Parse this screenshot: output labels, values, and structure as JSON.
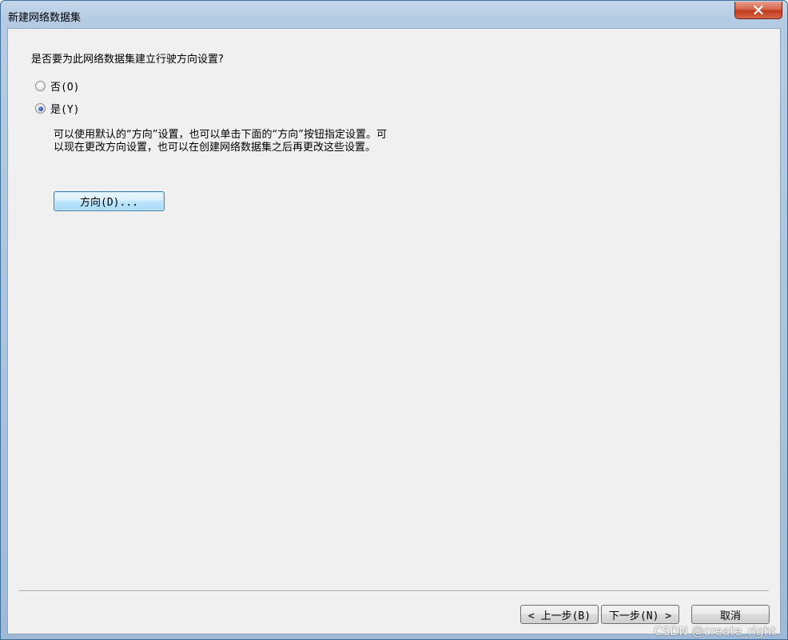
{
  "window": {
    "title": "新建网络数据集"
  },
  "question": "是否要为此网络数据集建立行驶方向设置?",
  "options": [
    {
      "label": "否(O)",
      "checked": false
    },
    {
      "label": "是(Y)",
      "checked": true
    }
  ],
  "description": {
    "line1": "可以使用默认的“方向”设置，也可以单击下面的“方向”按钮指定设置。可",
    "line2": "以现在更改方向设置，也可以在创建网络数据集之后再更改这些设置。"
  },
  "directions_button": "方向(D)...",
  "footer": {
    "back_label": "< 上一步(B)",
    "next_label": "下一步(N) >",
    "cancel_label": "取消"
  },
  "watermark": "CSDN @create_right",
  "colors": {
    "accent": "#3c7fb1",
    "close_red": "#c13a1d",
    "panel_bg": "#f0f0f0"
  },
  "icons": {
    "close": "close-x-icon",
    "radio_unchecked": "radio-unchecked-icon",
    "radio_checked": "radio-checked-icon"
  }
}
